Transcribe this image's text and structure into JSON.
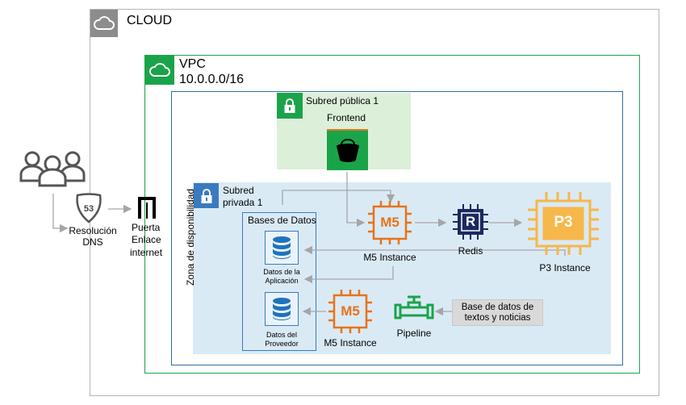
{
  "cloud": {
    "label": "CLOUD"
  },
  "vpc": {
    "label": "VPC",
    "cidr": "10.0.0.0/16"
  },
  "availability_zone": {
    "label": "Zona de disponibilidad"
  },
  "public_subnet": {
    "label": "Subred pública 1",
    "frontend_label": "Frontend"
  },
  "private_subnet": {
    "label_line1": "Subred",
    "label_line2": "privada 1"
  },
  "databases": {
    "title": "Bases de Datos",
    "app_db": {
      "line1": "Datos de la",
      "line2": "Aplicación"
    },
    "provider_db": {
      "line1": "Datos del",
      "line2": "Proveedor"
    }
  },
  "dns": {
    "badge": "53",
    "line1": "Resolución",
    "line2": "DNS"
  },
  "gateway": {
    "line1": "Puerta",
    "line2": "Enlace",
    "line3": "internet"
  },
  "m5_top": {
    "chip": "M5",
    "label": "M5 Instance"
  },
  "m5_bottom": {
    "chip": "M5",
    "label": "M5 Instance"
  },
  "redis": {
    "chip": "R",
    "label": "Redis"
  },
  "p3": {
    "chip": "P3",
    "label": "P3 Instance"
  },
  "pipeline": {
    "label": "Pipeline"
  },
  "text_db": {
    "line1": "Base de datos de",
    "line2": "textos y noticias"
  },
  "icons": {
    "users": "users-icon",
    "cloud": "cloud-icon",
    "lock": "lock-icon",
    "bucket": "bucket-icon",
    "database": "database-icon",
    "chip": "chip-icon",
    "route-shield": "route-shield-icon",
    "gateway": "gateway-icon",
    "pipeline": "pipeline-icon"
  },
  "colors": {
    "cloud_gray": "#8c8c8c",
    "vpc_green": "#1aa44a",
    "inner_blue": "#2e6da4",
    "public_bg": "#dcf0d9",
    "private_bg": "#daeaf5",
    "orange": "#e8731a",
    "p3_orange": "#f7b74a",
    "redis_navy": "#1b2a5e",
    "db_blue": "#1e73be",
    "arrow_gray": "#a6a6a6"
  }
}
